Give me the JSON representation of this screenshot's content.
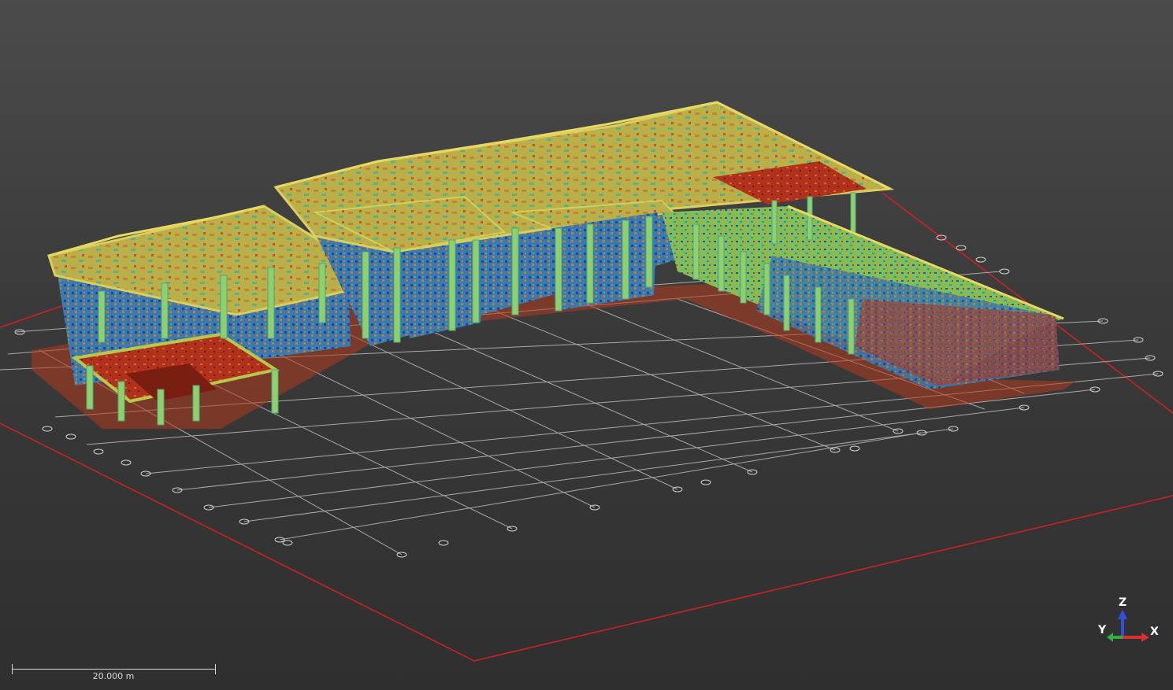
{
  "viewer": {
    "background_top": "#4b4b4b",
    "background_bottom": "#2f2f2f",
    "bounding_box_color": "#d42020",
    "grid_color": "#bdbdbd",
    "colormap": [
      "#1e3ca8",
      "#2aa5a0",
      "#55c88a",
      "#b8c84a",
      "#d68a2a",
      "#c02a1a"
    ]
  },
  "scale_bar": {
    "label": "20.000 m"
  },
  "axis_gizmo": {
    "z_label": "Z",
    "y_label": "Y",
    "x_label": "X",
    "x_color": "#d83030",
    "y_color": "#30b040",
    "z_color": "#3050e0"
  },
  "scene": {
    "object": "point-cloud-building",
    "icon": "axis-triad-icon"
  }
}
